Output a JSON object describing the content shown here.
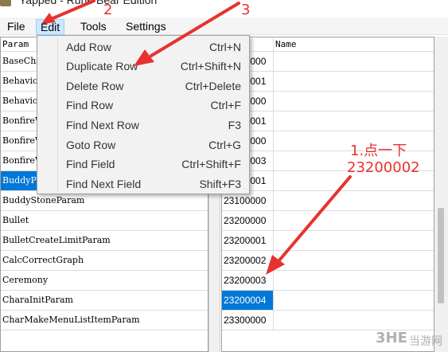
{
  "window": {
    "title": "Yapped - Rune Bear Edition"
  },
  "menu_bar": [
    {
      "label": "File"
    },
    {
      "label": "Edit"
    },
    {
      "label": "Tools"
    },
    {
      "label": "Settings"
    }
  ],
  "edit_menu": [
    {
      "label": "Add Row",
      "shortcut": "Ctrl+N"
    },
    {
      "label": "Duplicate Row",
      "shortcut": "Ctrl+Shift+N"
    },
    {
      "label": "Delete Row",
      "shortcut": "Ctrl+Delete"
    },
    {
      "label": "Find Row",
      "shortcut": "Ctrl+F"
    },
    {
      "label": "Find Next Row",
      "shortcut": "F3"
    },
    {
      "label": "Goto Row",
      "shortcut": "Ctrl+G"
    },
    {
      "label": "Find Field",
      "shortcut": "Ctrl+Shift+F"
    },
    {
      "label": "Find Next Field",
      "shortcut": "Shift+F3"
    }
  ],
  "params_table": {
    "header": "Param",
    "rows": [
      {
        "name": "BaseChrSelectMenuParam"
      },
      {
        "name": "BehaviorParam"
      },
      {
        "name": "BehaviorParam_PC"
      },
      {
        "name": "BonfireWarpParam"
      },
      {
        "name": "BonfireWarpSubCategoryParam"
      },
      {
        "name": "BonfireWarpTabParam"
      },
      {
        "name": "BuddyParam"
      },
      {
        "name": "BuddyStoneParam"
      },
      {
        "name": "Bullet"
      },
      {
        "name": "BulletCreateLimitParam"
      },
      {
        "name": "CalcCorrectGraph"
      },
      {
        "name": "Ceremony"
      },
      {
        "name": "CharaInitParam"
      },
      {
        "name": "CharMakeMenuListItemParam"
      }
    ]
  },
  "rows_table": {
    "headers": [
      "ID",
      "Name"
    ],
    "rows": [
      {
        "id": "23200000",
        "name": ""
      },
      {
        "id": "23200001",
        "name": ""
      },
      {
        "id": "23200000",
        "name": ""
      },
      {
        "id": "23200001",
        "name": ""
      },
      {
        "id": "23200000",
        "name": ""
      },
      {
        "id": "23200003",
        "name": ""
      },
      {
        "id": "23200001",
        "name": ""
      },
      {
        "id": "23100000",
        "name": ""
      },
      {
        "id": "23200000",
        "name": ""
      },
      {
        "id": "23200001",
        "name": ""
      },
      {
        "id": "23200002",
        "name": ""
      },
      {
        "id": "23200003",
        "name": ""
      },
      {
        "id": "23200004",
        "name": ""
      },
      {
        "id": "23300000",
        "name": ""
      }
    ]
  },
  "selected": {
    "param_row": "BuddyParam",
    "id_row": "23200004"
  },
  "annotations": {
    "num2": "2",
    "num3": "3",
    "note1": "1.点一下",
    "note1_value": "23200002",
    "color": "#e8322f"
  },
  "watermark": {
    "logo": "3HE",
    "text": "当游网"
  }
}
